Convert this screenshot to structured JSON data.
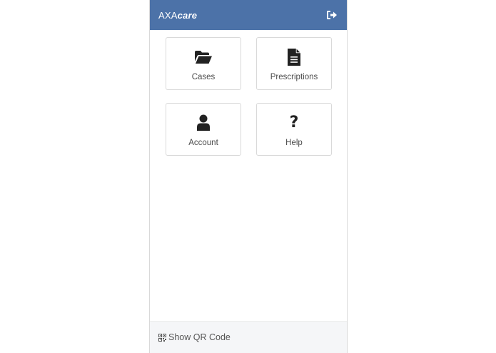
{
  "header": {
    "brand_prefix": "AXA",
    "brand_suffix": "care",
    "logout_icon": "sign-out-icon"
  },
  "tiles": [
    {
      "label": "Cases",
      "icon": "folder-open-icon"
    },
    {
      "label": "Prescriptions",
      "icon": "file-text-icon"
    },
    {
      "label": "Account",
      "icon": "user-icon"
    },
    {
      "label": "Help",
      "icon": "question-icon",
      "glyph": "?"
    }
  ],
  "footer": {
    "label": "Show QR Code",
    "icon": "qr-code-icon"
  },
  "colors": {
    "header_bg": "#4c72a8",
    "footer_bg": "#f5f6f8",
    "tile_border": "#d9d9d9"
  }
}
